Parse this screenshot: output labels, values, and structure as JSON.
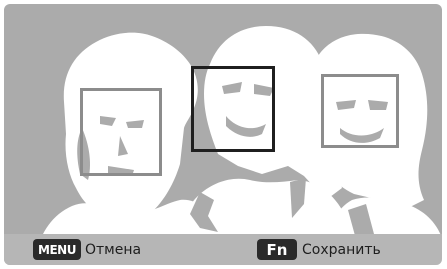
{
  "footer": {
    "menu_key": "MENU",
    "cancel_label": "Отмена",
    "fn_key": "Fn",
    "save_label": "Сохранить"
  },
  "colors": {
    "background": "#ababab",
    "silhouette": "#ffffff",
    "selected_frame": "#1f1f1f",
    "unselected_frame": "#8c8c8c",
    "bottom_bar": "#b6b6b6"
  },
  "faces": {
    "detected_count": 3,
    "selected_index": 1
  }
}
